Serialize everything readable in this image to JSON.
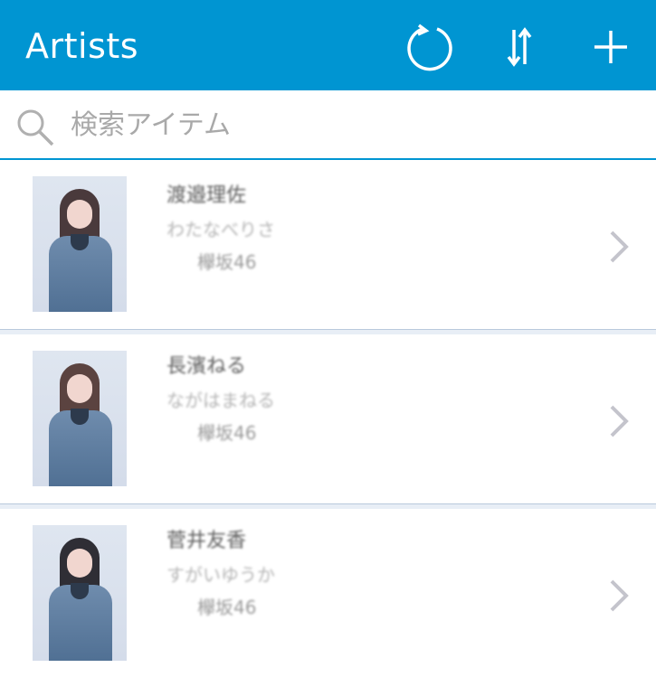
{
  "header": {
    "title": "Artists",
    "background_color": "#0095d2",
    "actions": [
      {
        "name": "refresh",
        "icon": "refresh-icon"
      },
      {
        "name": "sort",
        "icon": "sort-icon"
      },
      {
        "name": "add",
        "icon": "plus-icon"
      }
    ]
  },
  "search": {
    "placeholder": "検索アイテム",
    "value": "",
    "icon": "search-icon"
  },
  "artists": [
    {
      "name": "渡邉理佐",
      "reading": "わたなべりさ",
      "group": "欅坂46"
    },
    {
      "name": "長濱ねる",
      "reading": "ながはまねる",
      "group": "欅坂46"
    },
    {
      "name": "菅井友香",
      "reading": "すがいゆうか",
      "group": "欅坂46"
    }
  ],
  "colors": {
    "accent": "#0095d2",
    "separator": "#e8eef6",
    "chevron": "#c4c4cc"
  }
}
